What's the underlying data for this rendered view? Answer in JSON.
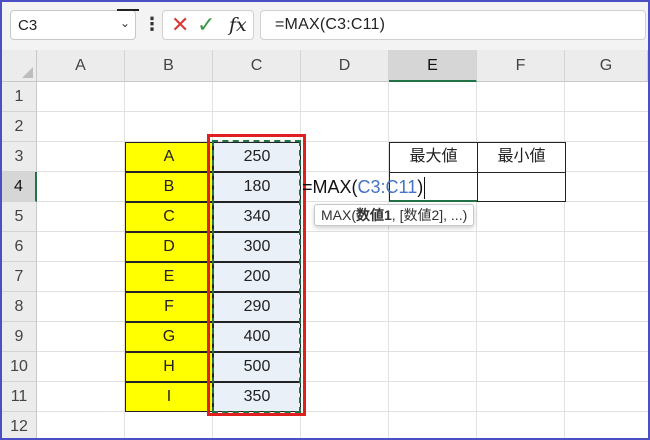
{
  "name_box": {
    "value": "C3"
  },
  "formula_bar": {
    "formula": "=MAX(C3:C11)",
    "cancel_icon": "cancel-x-icon",
    "enter_icon": "checkmark-icon",
    "function_icon": "fx-icon"
  },
  "columns": [
    "A",
    "B",
    "C",
    "D",
    "E",
    "F",
    "G"
  ],
  "rows": [
    "1",
    "2",
    "3",
    "4",
    "5",
    "6",
    "7",
    "8",
    "9",
    "10",
    "11",
    "12"
  ],
  "column_b": [
    "A",
    "B",
    "C",
    "D",
    "E",
    "F",
    "G",
    "H",
    "I"
  ],
  "column_c": [
    "250",
    "180",
    "340",
    "300",
    "200",
    "290",
    "400",
    "500",
    "350"
  ],
  "summary": {
    "max_label": "最大値",
    "min_label": "最小値"
  },
  "edit": {
    "prefix": "=MAX(",
    "ref": "C3:C11",
    "suffix": ")"
  },
  "tooltip": {
    "fn": "MAX(",
    "arg1": "数値1",
    "rest": ", [数値2], ...)"
  },
  "colors": {
    "highlight_yellow": "#ffff00",
    "range_fill": "#eaf0f8",
    "range_border": "#e02020",
    "marching_ants": "#217346",
    "reference_blue": "#4472c4",
    "frame_border": "#4a4fc4"
  }
}
